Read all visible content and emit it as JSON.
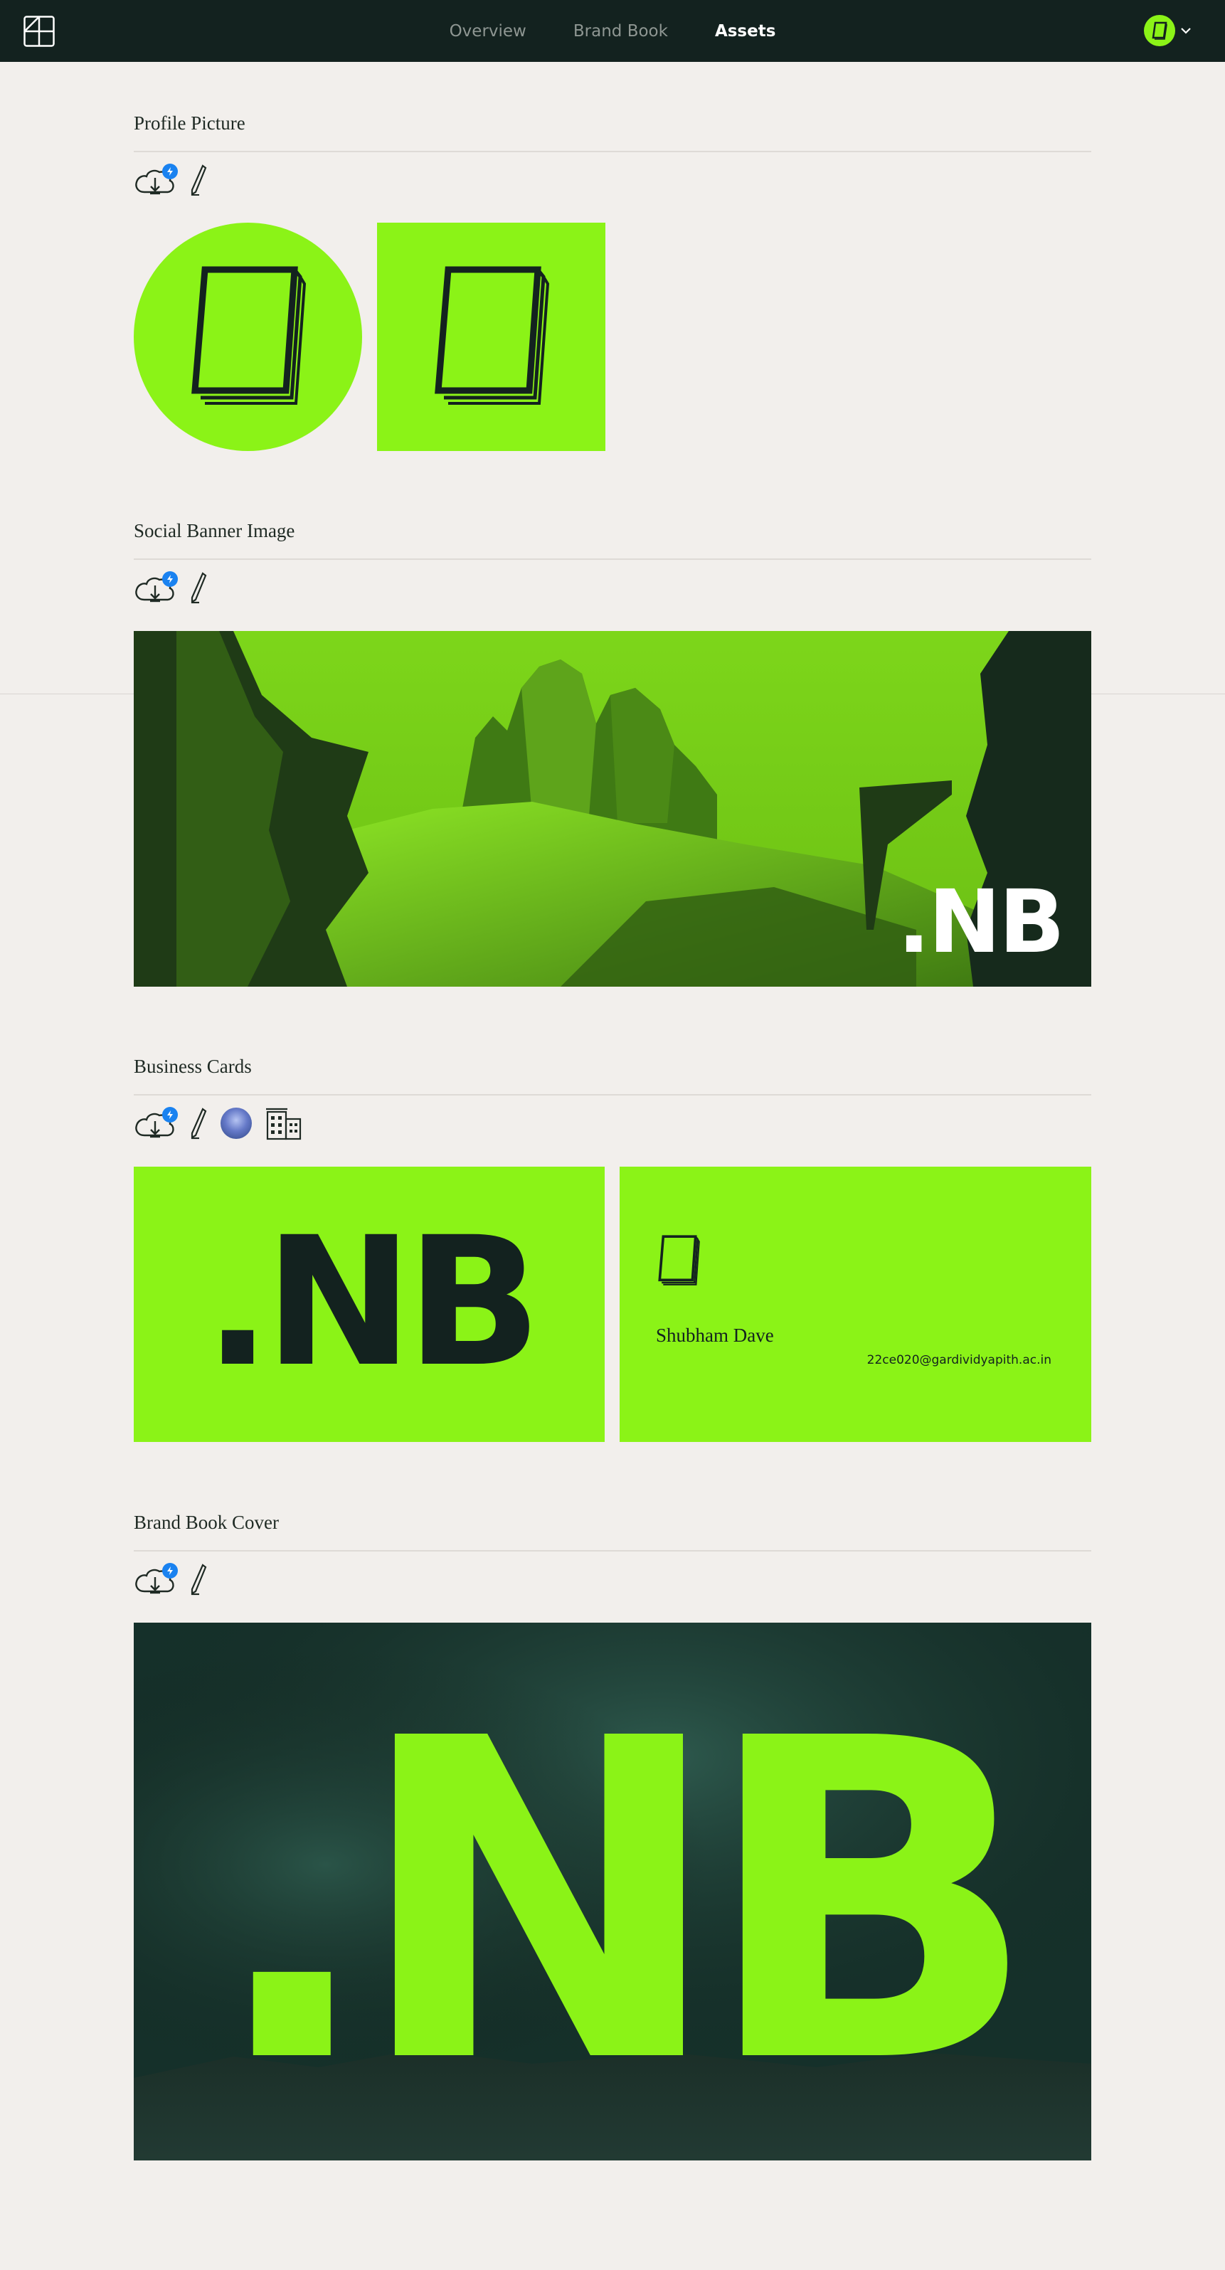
{
  "nav": {
    "links": [
      {
        "label": "Overview",
        "active": false
      },
      {
        "label": "Brand Book",
        "active": false
      },
      {
        "label": "Assets",
        "active": true
      }
    ]
  },
  "colors": {
    "accent": "#8bf317",
    "dark": "#13221f",
    "background": "#f2efec",
    "badge": "#1a82f0"
  },
  "sections": {
    "profile": {
      "title": "Profile Picture"
    },
    "banner": {
      "title": "Social Banner Image",
      "logo_text": ".NB"
    },
    "business_cards": {
      "title": "Business Cards",
      "front_text": ".NB",
      "name": "Shubham Dave",
      "email": "22ce020@gardividyapith.ac.in"
    },
    "book_cover": {
      "title": "Brand Book Cover",
      "logo_text": ".NB"
    }
  },
  "icons": {
    "download": "download-cloud-icon",
    "badge": "lightning-bolt-icon",
    "edit": "pen-icon",
    "user": "avatar",
    "company": "building-icon"
  }
}
